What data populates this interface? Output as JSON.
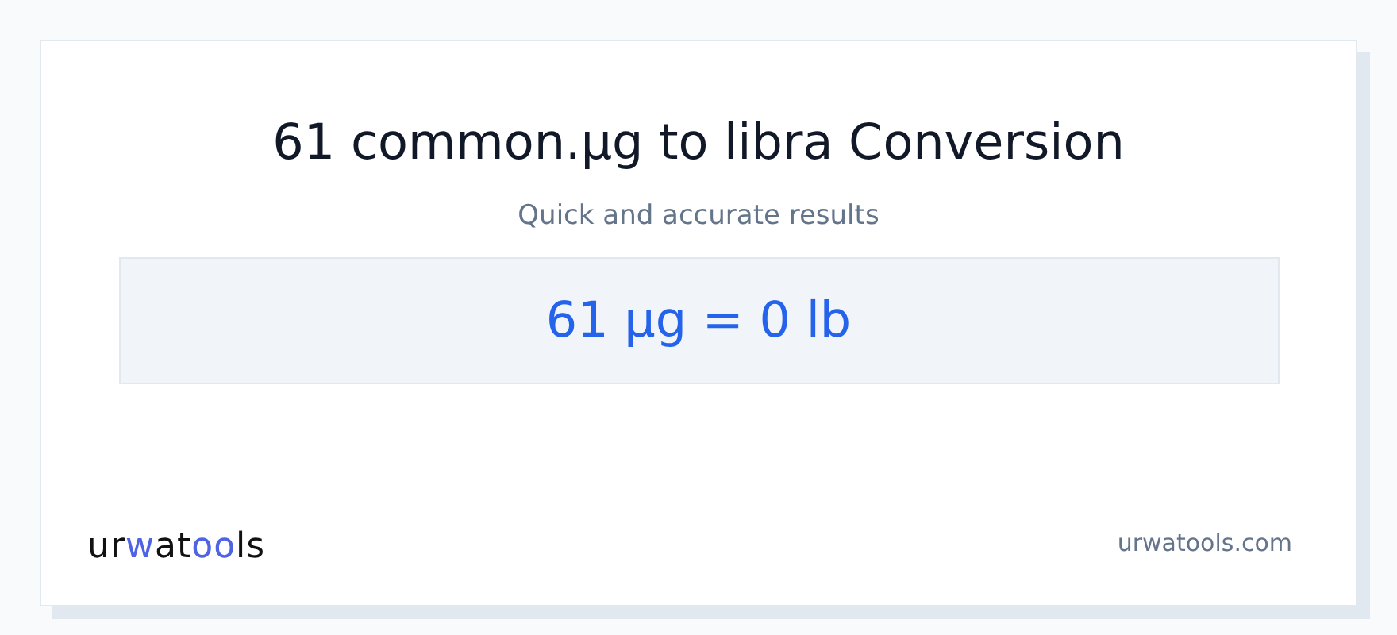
{
  "title": "61 common.µg to libra Conversion",
  "subtitle": "Quick and accurate results",
  "result": "61 µg = 0 lb",
  "logo": [
    {
      "text": "ur",
      "accent": false
    },
    {
      "text": "w",
      "accent": true
    },
    {
      "text": "at",
      "accent": false
    },
    {
      "text": "oo",
      "accent": true
    },
    {
      "text": "ls",
      "accent": false
    }
  ],
  "site": "urwatools.com"
}
